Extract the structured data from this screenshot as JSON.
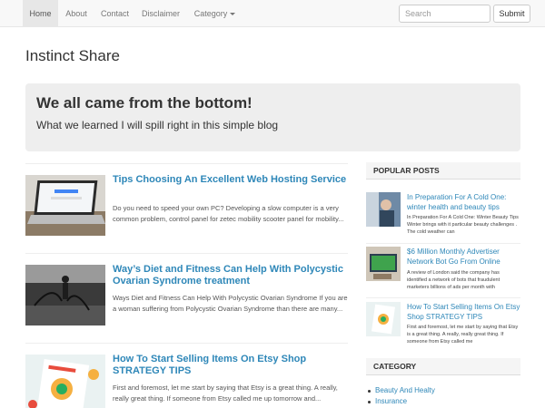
{
  "nav": {
    "items": [
      "Home",
      "About",
      "Contact",
      "Disclaimer",
      "Category"
    ],
    "search_placeholder": "Search",
    "submit_label": "Submit"
  },
  "site": {
    "title": "Instinct Share"
  },
  "jumbotron": {
    "title": "We all came from the bottom!",
    "subtitle": "What we learned I will spill right in this simple blog"
  },
  "posts": [
    {
      "title": "Tips Choosing An Excellent Web Hosting Service",
      "excerpt": "Do you need to speed your own PC? Developing a slow computer is a very common problem, control panel for zetec mobility scooter panel for mobility..."
    },
    {
      "title": "Way’s Diet and Fitness Can Help With Polycystic Ovarian Syndrome treatment",
      "excerpt": "Ways Diet and Fitness Can Help With Polycystic Ovarian Syndrome If you are a woman suffering from Polycystic Ovarian Syndrome than there are many..."
    },
    {
      "title": "How To Start Selling Items On Etsy Shop STRATEGY TIPS",
      "excerpt": "First and foremost, let me start by saying that Etsy is a great thing. A really, really great thing. If someone from Etsy called me up tomorrow and..."
    }
  ],
  "sidebar": {
    "popular_heading": "POPULAR POSTS",
    "popular": [
      {
        "title": "In Preparation For A Cold One: winter health and beauty tips",
        "excerpt": "In Preparation For A Cold One: Winter Beauty Tips Winter brings with it particular beauty challenges . The cold weather can"
      },
      {
        "title": "$6 Million Monthly Advertiser Network Bot Go From Online",
        "excerpt": "A review of London said the company has identified a network of bots that fraudulent marketers billions of ads per month with"
      },
      {
        "title": "How To Start Selling Items On Etsy Shop STRATEGY TIPS",
        "excerpt": "First and foremost, let me start by saying that Etsy is a great thing. A really, really great thing. If someone from Etsy called me"
      }
    ],
    "category_heading": "CATEGORY",
    "categories": [
      "Beauty And Healty",
      "Insurance"
    ]
  }
}
